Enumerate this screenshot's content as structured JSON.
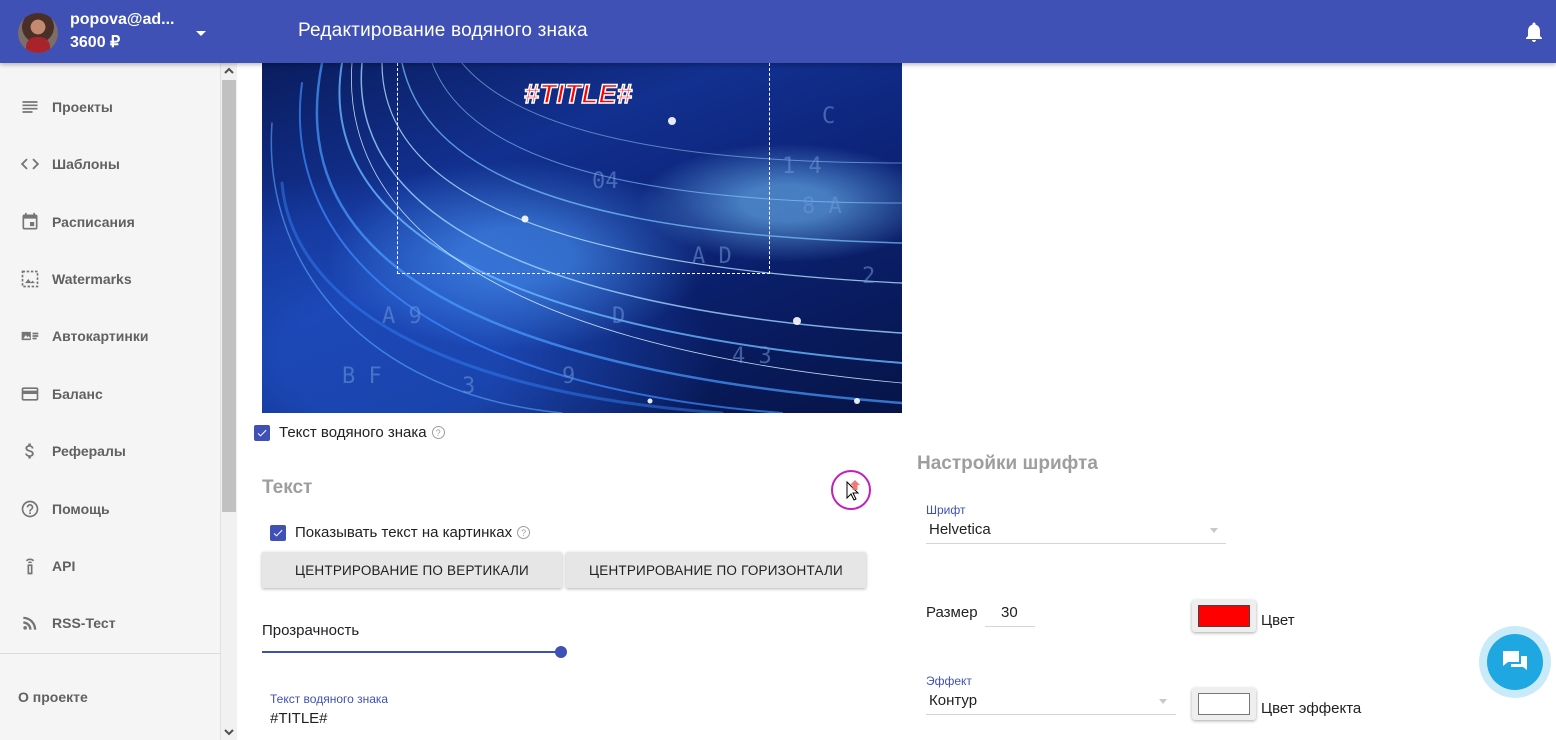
{
  "header": {
    "user_email": "popova@ad...",
    "user_balance": "3600 ₽",
    "page_title": "Редактирование водяного знака",
    "color": "#3f51b5"
  },
  "sidebar": {
    "items": [
      {
        "label": "Проекты",
        "icon": "list-icon"
      },
      {
        "label": "Шаблоны",
        "icon": "code-icon"
      },
      {
        "label": "Расписания",
        "icon": "calendar-icon"
      },
      {
        "label": "Watermarks",
        "icon": "image-icon"
      },
      {
        "label": "Автокартинки",
        "icon": "auto-image-icon"
      },
      {
        "label": "Баланс",
        "icon": "credit-card-icon"
      },
      {
        "label": "Рефералы",
        "icon": "dollar-icon"
      },
      {
        "label": "Помощь",
        "icon": "help-circle-icon"
      },
      {
        "label": "API",
        "icon": "api-icon"
      },
      {
        "label": "RSS-Тест",
        "icon": "rss-icon"
      }
    ],
    "about": "О проекте"
  },
  "preview": {
    "watermark_text": "#TITLE#"
  },
  "watermark_text_toggle": {
    "label": "Текст водяного знака",
    "checked": true
  },
  "text_section": {
    "title": "Текст",
    "show_text": {
      "label": "Показывать текст на картинках",
      "checked": true
    },
    "center_vertical": "ЦЕНТРИРОВАНИЕ ПО ВЕРТИКАЛИ",
    "center_horizontal": "ЦЕНТРИРОВАНИЕ ПО ГОРИЗОНТАЛИ",
    "opacity_label": "Прозрачность",
    "opacity_value": 1.0,
    "watermark_field_label": "Текст водяного знака",
    "watermark_field_value": "#TITLE#"
  },
  "font_section": {
    "title": "Настройки шрифта",
    "font_label": "Шрифт",
    "font_value": "Helvetica",
    "size_label": "Размер",
    "size_value": "30",
    "color_label": "Цвет",
    "color_value": "#ff0000",
    "effect_label": "Эффект",
    "effect_value": "Контур",
    "effect_color_label": "Цвет эффекта",
    "effect_color_value": "#ffffff"
  }
}
